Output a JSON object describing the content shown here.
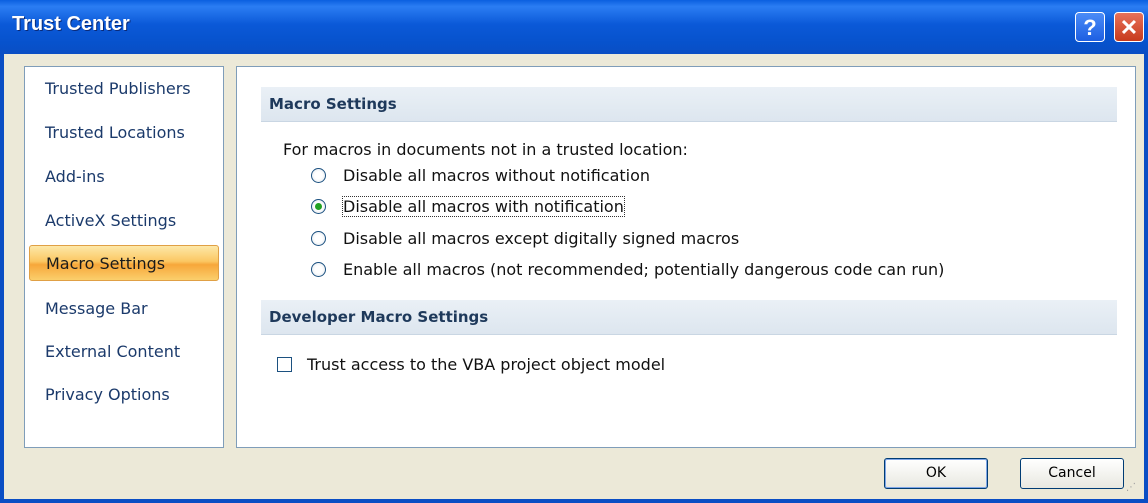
{
  "window": {
    "title": "Trust Center",
    "help_glyph": "?",
    "close_glyph": "✕"
  },
  "sidebar": {
    "items": [
      {
        "label": "Trusted Publishers",
        "selected": false
      },
      {
        "label": "Trusted Locations",
        "selected": false
      },
      {
        "label": "Add-ins",
        "selected": false
      },
      {
        "label": "ActiveX Settings",
        "selected": false
      },
      {
        "label": "Macro Settings",
        "selected": true
      },
      {
        "label": "Message Bar",
        "selected": false
      },
      {
        "label": "External Content",
        "selected": false
      },
      {
        "label": "Privacy Options",
        "selected": false
      }
    ]
  },
  "macro_settings": {
    "header": "Macro Settings",
    "prompt": "For macros in documents not in a trusted location:",
    "options": [
      {
        "label": "Disable all macros without notification",
        "selected": false
      },
      {
        "label": "Disable all macros with notification",
        "selected": true
      },
      {
        "label": "Disable all macros except digitally signed macros",
        "selected": false
      },
      {
        "label": "Enable all macros (not recommended; potentially dangerous code can run)",
        "selected": false
      }
    ]
  },
  "developer_settings": {
    "header": "Developer Macro Settings",
    "checkbox_label": "Trust access to the VBA project object model",
    "checked": false
  },
  "buttons": {
    "ok": "OK",
    "cancel": "Cancel"
  },
  "colors": {
    "title_bar": "#0a5fe0",
    "selected_item": "#fbc763",
    "section_header": "#dde6ef",
    "radio_dot": "#21a121"
  }
}
